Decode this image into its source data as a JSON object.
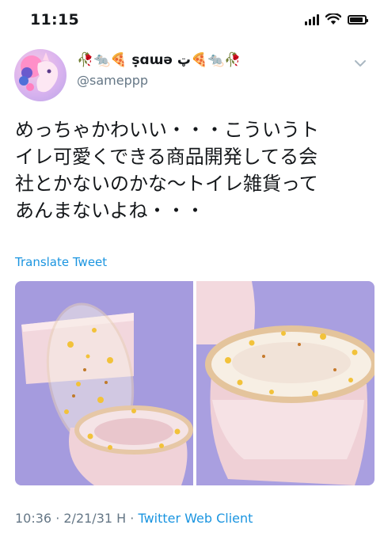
{
  "status": {
    "time": "11:15"
  },
  "tweet": {
    "display_name": "🥀🐀🍕 ṣɑɯə ټ🍕🐀🥀",
    "handle": "@sameppp",
    "text": "めっちゃかわいい・・・こういうト\nイレ可愛くできる商品開発してる会\n社とかないのかな〜トイレ雑貨って\nあんまないよね・・・",
    "translate_label": "Translate Tweet",
    "timestamp": "10:36 · 2/21/31 H",
    "separator": " · ",
    "client": "Twitter Web Client"
  },
  "icons": {
    "wifi": "wifi-icon",
    "signal": "cellular-signal-icon",
    "battery": "battery-icon",
    "chevron": "chevron-down-icon"
  },
  "colors": {
    "link": "#1b95e0",
    "secondary_text": "#657786",
    "photo_background": "#a99fe0",
    "toilet": "#f3dbe0"
  }
}
